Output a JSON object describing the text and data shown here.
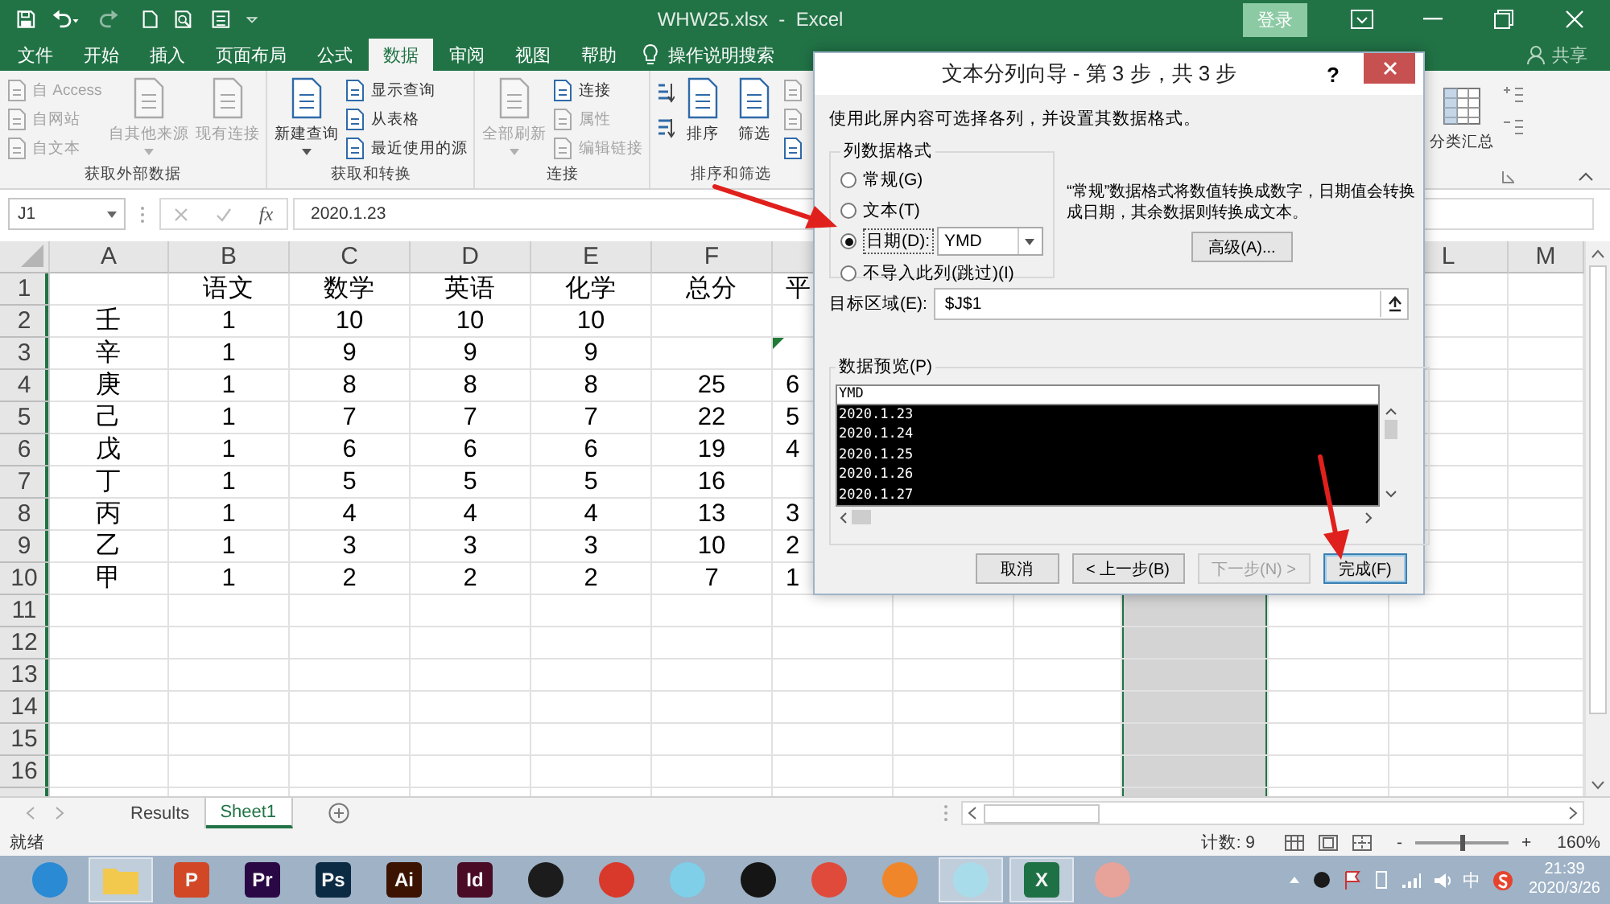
{
  "window": {
    "title": "WHW25.xlsx  -  Excel",
    "sign_in": "登录"
  },
  "ribbon_tabs": [
    {
      "label": "文件",
      "selected": false
    },
    {
      "label": "开始",
      "selected": false
    },
    {
      "label": "插入",
      "selected": false
    },
    {
      "label": "页面布局",
      "selected": false
    },
    {
      "label": "公式",
      "selected": false
    },
    {
      "label": "数据",
      "selected": true
    },
    {
      "label": "审阅",
      "selected": false
    },
    {
      "label": "视图",
      "selected": false
    },
    {
      "label": "帮助",
      "selected": false
    }
  ],
  "tell_me": "操作说明搜索",
  "share": "共享",
  "ribbon_groups": [
    {
      "title": "获取外部数据",
      "items": [
        {
          "kind": "small",
          "label": "自 Access",
          "disabled": true
        },
        {
          "kind": "small",
          "label": "自网站",
          "disabled": true
        },
        {
          "kind": "small",
          "label": "自文本",
          "disabled": true
        },
        {
          "kind": "large",
          "label": "自其他来源",
          "disabled": true,
          "dropdown": true
        },
        {
          "kind": "large",
          "label": "现有连接",
          "disabled": true,
          "dropdown": false
        }
      ]
    },
    {
      "title": "获取和转换",
      "items": [
        {
          "kind": "large",
          "label": "新建查询",
          "disabled": false,
          "dropdown": true
        },
        {
          "kind": "small",
          "label": "显示查询",
          "disabled": false
        },
        {
          "kind": "small",
          "label": "从表格",
          "disabled": false
        },
        {
          "kind": "small",
          "label": "最近使用的源",
          "disabled": false
        }
      ]
    },
    {
      "title": "连接",
      "items": [
        {
          "kind": "large",
          "label": "全部刷新",
          "disabled": true,
          "dropdown": true
        },
        {
          "kind": "small",
          "label": "连接",
          "disabled": false
        },
        {
          "kind": "small",
          "label": "属性",
          "disabled": true
        },
        {
          "kind": "small",
          "label": "编辑链接",
          "disabled": true
        }
      ]
    },
    {
      "title": "排序和筛选",
      "items": [
        {
          "kind": "sort"
        },
        {
          "kind": "large",
          "label": "排序",
          "disabled": false,
          "dropdown": false
        },
        {
          "kind": "large",
          "label": "筛选",
          "disabled": false,
          "dropdown": false
        },
        {
          "kind": "small",
          "disabled": true
        },
        {
          "kind": "small",
          "disabled": true
        },
        {
          "kind": "small",
          "disabled": false
        }
      ]
    }
  ],
  "outline": {
    "label": "分类汇总"
  },
  "name_box": "J1",
  "function_label": "fx",
  "formula": "2020.1.23",
  "sheet": {
    "columns": [
      {
        "label": "A",
        "selected": false
      },
      {
        "label": "B",
        "selected": false
      },
      {
        "label": "C",
        "selected": false
      },
      {
        "label": "D",
        "selected": false
      },
      {
        "label": "E",
        "selected": false
      },
      {
        "label": "F",
        "selected": false
      },
      {
        "selected": false
      },
      {
        "selected": false
      },
      {
        "selected": false
      },
      {
        "selected": true
      },
      {
        "selected": false
      },
      {
        "label": "L",
        "selected": false
      },
      {
        "label": "M",
        "selected": false
      }
    ],
    "rows": [
      {
        "label": "1",
        "warning": false,
        "cells": [
          null,
          "语文",
          "数学",
          "英语",
          "化学",
          "总分",
          "平"
        ]
      },
      {
        "label": "2",
        "warning": false,
        "cells": [
          "壬",
          "1",
          "10",
          "10",
          "10"
        ]
      },
      {
        "label": "3",
        "warning": true,
        "cells": [
          "辛",
          "1",
          "9",
          "9",
          "9"
        ]
      },
      {
        "label": "4",
        "warning": false,
        "cells": [
          "庚",
          "1",
          "8",
          "8",
          "8",
          "25",
          "6"
        ]
      },
      {
        "label": "5",
        "warning": false,
        "cells": [
          "己",
          "1",
          "7",
          "7",
          "7",
          "22",
          "5"
        ]
      },
      {
        "label": "6",
        "warning": false,
        "cells": [
          "戊",
          "1",
          "6",
          "6",
          "6",
          "19",
          "4"
        ]
      },
      {
        "label": "7",
        "warning": false,
        "cells": [
          "丁",
          "1",
          "5",
          "5",
          "5",
          "16"
        ]
      },
      {
        "label": "8",
        "warning": false,
        "cells": [
          "丙",
          "1",
          "4",
          "4",
          "4",
          "13",
          "3"
        ]
      },
      {
        "label": "9",
        "warning": false,
        "cells": [
          "乙",
          "1",
          "3",
          "3",
          "3",
          "10",
          "2"
        ]
      },
      {
        "label": "10",
        "warning": false,
        "cells": [
          "甲",
          "1",
          "2",
          "2",
          "2",
          "7",
          "1"
        ]
      },
      {
        "label": "11",
        "warning": false,
        "cells": []
      },
      {
        "label": "12",
        "warning": false,
        "cells": []
      },
      {
        "label": "13",
        "warning": false,
        "cells": []
      },
      {
        "label": "14",
        "warning": false,
        "cells": []
      },
      {
        "label": "15",
        "warning": false,
        "cells": []
      },
      {
        "label": "16",
        "warning": false,
        "cells": []
      }
    ]
  },
  "sheet_tabs": [
    {
      "label": "Results",
      "selected": false
    },
    {
      "label": "Sheet1",
      "selected": true
    }
  ],
  "status_bar": {
    "ready": "就绪",
    "count": "计数: 9",
    "zoom_out": "-",
    "zoom_in": "+",
    "zoom_slider": {
      "level": 0.5
    },
    "zoom": "160%"
  },
  "dialog": {
    "title": "文本分列向导 - 第 3 步，共 3 步",
    "help": "?",
    "instruction": "使用此屏内容可选择各列，并设置其数据格式。",
    "format_group": "列数据格式",
    "formats": [
      {
        "label": "常规(G)",
        "selected": false
      },
      {
        "label": "文本(T)",
        "selected": false
      },
      {
        "label": "日期(D):",
        "selected": true,
        "format": "YMD"
      },
      {
        "label": "不导入此列(跳过)(I)",
        "selected": false
      }
    ],
    "description": "“常规”数据格式将数值转换成数字，日期值会转换成日期，其余数据则转换成文本。",
    "advanced": "高级(A)...",
    "destination_label": "目标区域(E):",
    "destination": "$J$1",
    "preview_label": "数据预览(P)",
    "preview_header": "YMD",
    "preview_rows": [
      "2020.1.23",
      "2020.1.24",
      "2020.1.25",
      "2020.1.26",
      "2020.1.27"
    ],
    "buttons": [
      {
        "label": "取消",
        "disabled": false,
        "default": false
      },
      {
        "label": "< 上一步(B)",
        "disabled": false,
        "default": false
      },
      {
        "label": "下一步(N) >",
        "disabled": true,
        "default": false
      },
      {
        "label": "完成(F)",
        "disabled": false,
        "default": true
      }
    ]
  },
  "taskbar": {
    "apps": [
      {
        "kind": "glyph",
        "color": "#2a8ad4",
        "selected": false
      },
      {
        "kind": "folder",
        "color": "#f2c94c",
        "selected": true
      },
      {
        "kind": "letter",
        "label": "P",
        "color": "#d24726",
        "selected": false
      },
      {
        "kind": "letter",
        "label": "Pr",
        "color": "#2a0845",
        "selected": false
      },
      {
        "kind": "letter",
        "label": "Ps",
        "color": "#0b2a44",
        "selected": false
      },
      {
        "kind": "letter",
        "label": "Ai",
        "color": "#3b1300",
        "selected": false
      },
      {
        "kind": "letter",
        "label": "Id",
        "color": "#4a0b26",
        "selected": false
      },
      {
        "kind": "glyph",
        "color": "#1c1c1c",
        "selected": false
      },
      {
        "kind": "glyph",
        "color": "#d8392b",
        "selected": false
      },
      {
        "kind": "glyph",
        "color": "#7fcfe8",
        "selected": false
      },
      {
        "kind": "glyph",
        "color": "#151515",
        "selected": false
      },
      {
        "kind": "glyph",
        "color": "#e04a3b",
        "selected": false
      },
      {
        "kind": "glyph",
        "color": "#f0862a",
        "selected": false
      },
      {
        "kind": "glyph",
        "color": "#a9dcea",
        "selected": true
      },
      {
        "kind": "letter",
        "label": "X",
        "color": "#1e7145",
        "selected": true
      },
      {
        "kind": "glyph",
        "color": "#e7a29a",
        "selected": false
      }
    ],
    "ime": "中",
    "time": "21:39",
    "date": "2020/3/26"
  }
}
